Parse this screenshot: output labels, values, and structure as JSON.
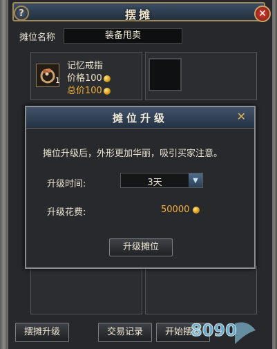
{
  "window": {
    "title": "摆摊",
    "help_label": "?",
    "close_label": "✕"
  },
  "stall": {
    "name_label": "摊位名称",
    "name_value": "装备甩卖"
  },
  "item": {
    "name": "记忆戒指",
    "count": "1",
    "price_label": "价格100",
    "total_label": "总价100",
    "icon": "ring-icon"
  },
  "dialog": {
    "title": "摊位升级",
    "close_label": "✕",
    "description": "摊位升级后，外形更加华丽，吸引买家注意。",
    "time_label": "升级时间:",
    "time_value": "3天",
    "cost_label": "升级花费:",
    "cost_value": "50000",
    "upgrade_button": "升级摊位"
  },
  "buttons": {
    "stall_upgrade": "摆摊升级",
    "trade_log": "交易记录",
    "start_stall": "开始摆摊"
  },
  "watermark": {
    "text": "8090"
  },
  "colors": {
    "gold_text": "#f5b236",
    "title_bar": "#2f4053",
    "frame_gold": "#a48a58",
    "close_red": "#c8372a"
  }
}
